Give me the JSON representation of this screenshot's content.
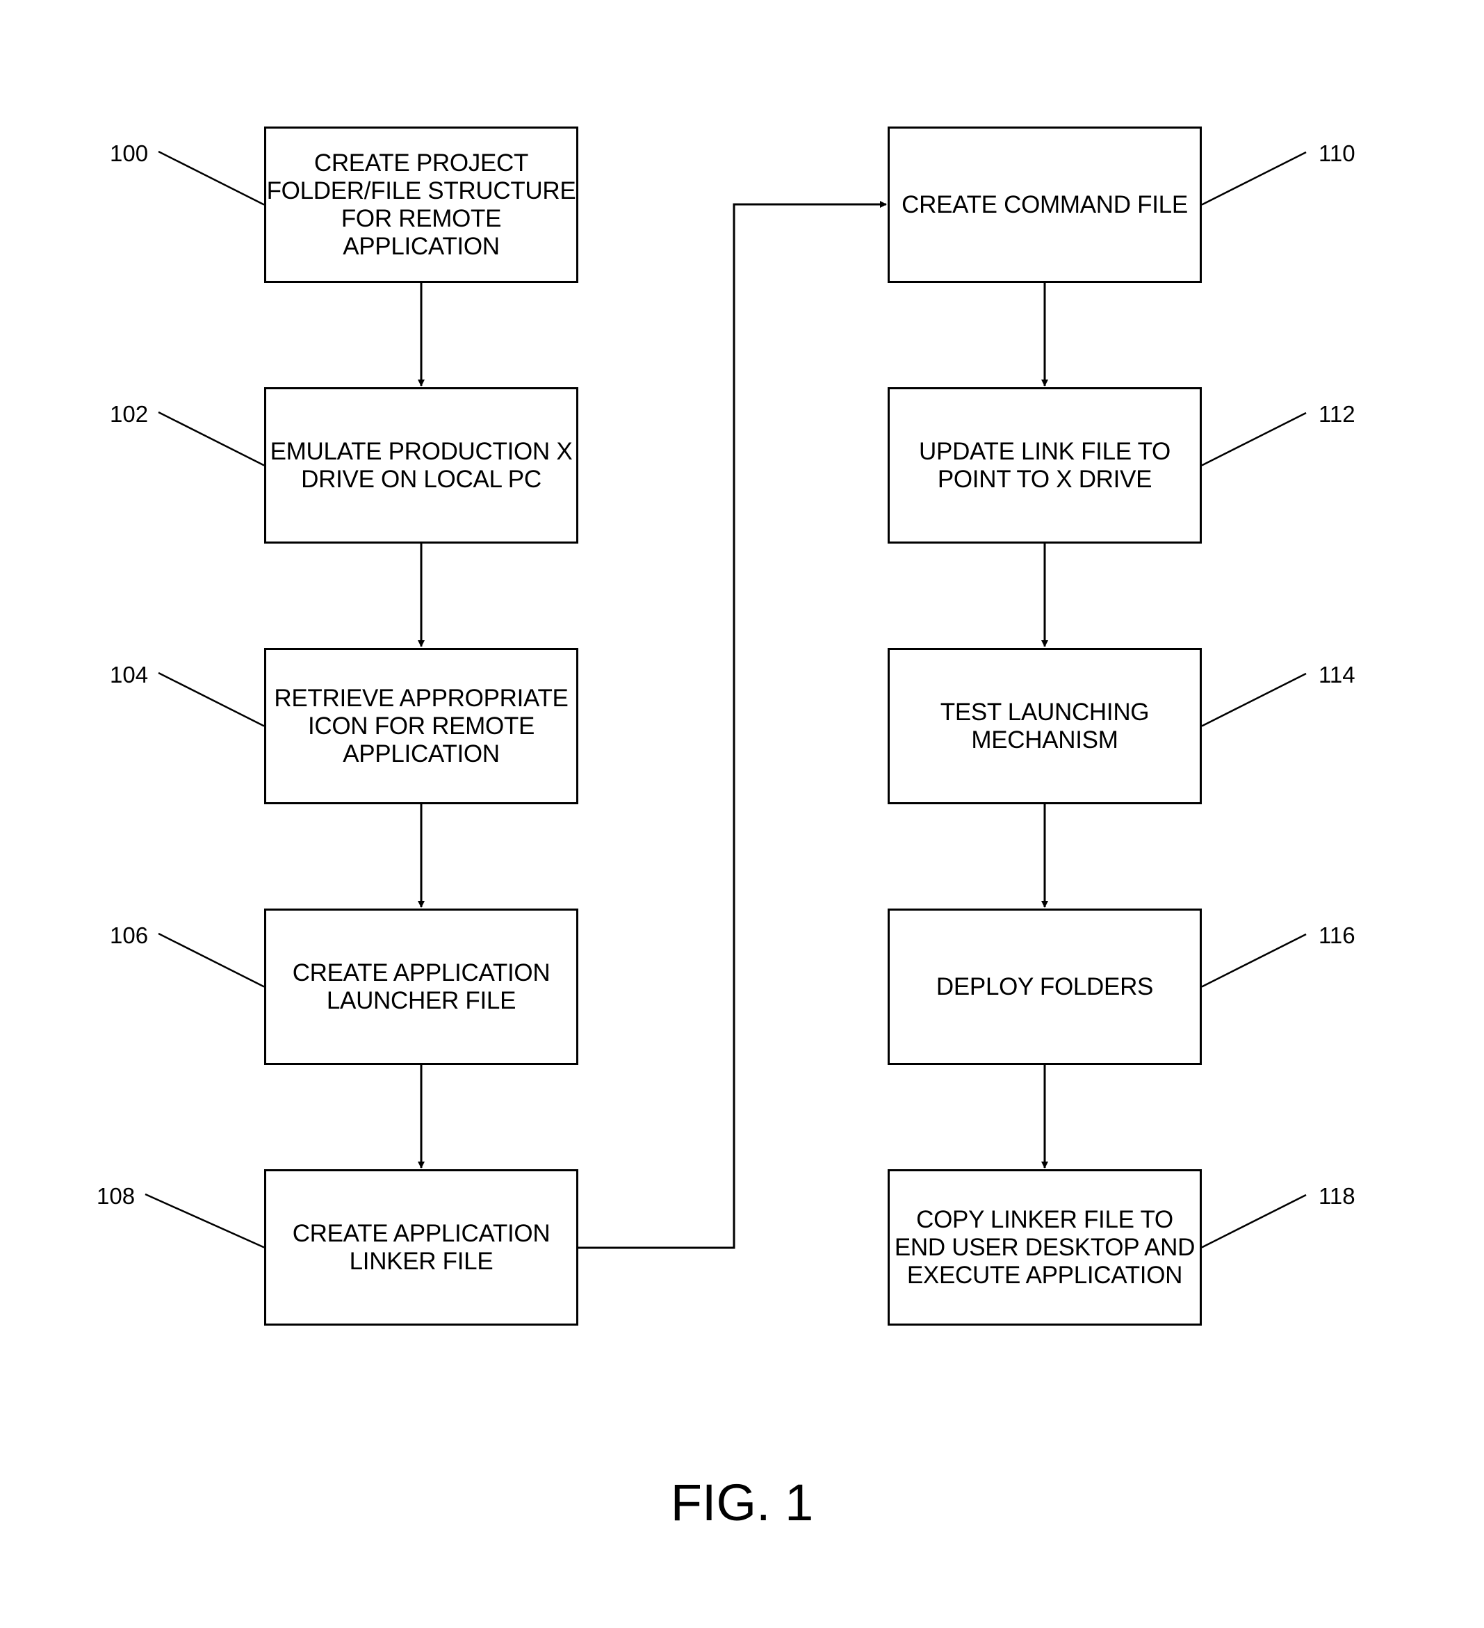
{
  "figure": {
    "caption": "FIG. 1",
    "colors": {
      "line": "#000000",
      "background": "#ffffff"
    }
  },
  "steps": [
    {
      "ref": "100",
      "text": "CREATE PROJECT\nFOLDER/FILE STRUCTURE\nFOR REMOTE\nAPPLICATION",
      "column": "left"
    },
    {
      "ref": "102",
      "text": "EMULATE PRODUCTION X\nDRIVE ON LOCAL PC",
      "column": "left"
    },
    {
      "ref": "104",
      "text": "RETRIEVE APPROPRIATE\nICON FOR REMOTE\nAPPLICATION",
      "column": "left"
    },
    {
      "ref": "106",
      "text": "CREATE APPLICATION\nLAUNCHER FILE",
      "column": "left"
    },
    {
      "ref": "108",
      "text": "CREATE APPLICATION\nLINKER FILE",
      "column": "left"
    },
    {
      "ref": "110",
      "text": "CREATE COMMAND FILE",
      "column": "right"
    },
    {
      "ref": "112",
      "text": "UPDATE LINK FILE TO\nPOINT TO X DRIVE",
      "column": "right"
    },
    {
      "ref": "114",
      "text": "TEST LAUNCHING\nMECHANISM",
      "column": "right"
    },
    {
      "ref": "116",
      "text": "DEPLOY FOLDERS",
      "column": "right"
    },
    {
      "ref": "118",
      "text": "COPY LINKER FILE TO\nEND USER DESKTOP AND\nEXECUTE APPLICATION",
      "column": "right"
    }
  ],
  "flow": [
    [
      "100",
      "102"
    ],
    [
      "102",
      "104"
    ],
    [
      "104",
      "106"
    ],
    [
      "106",
      "108"
    ],
    [
      "108",
      "110"
    ],
    [
      "110",
      "112"
    ],
    [
      "112",
      "114"
    ],
    [
      "114",
      "116"
    ],
    [
      "116",
      "118"
    ]
  ]
}
